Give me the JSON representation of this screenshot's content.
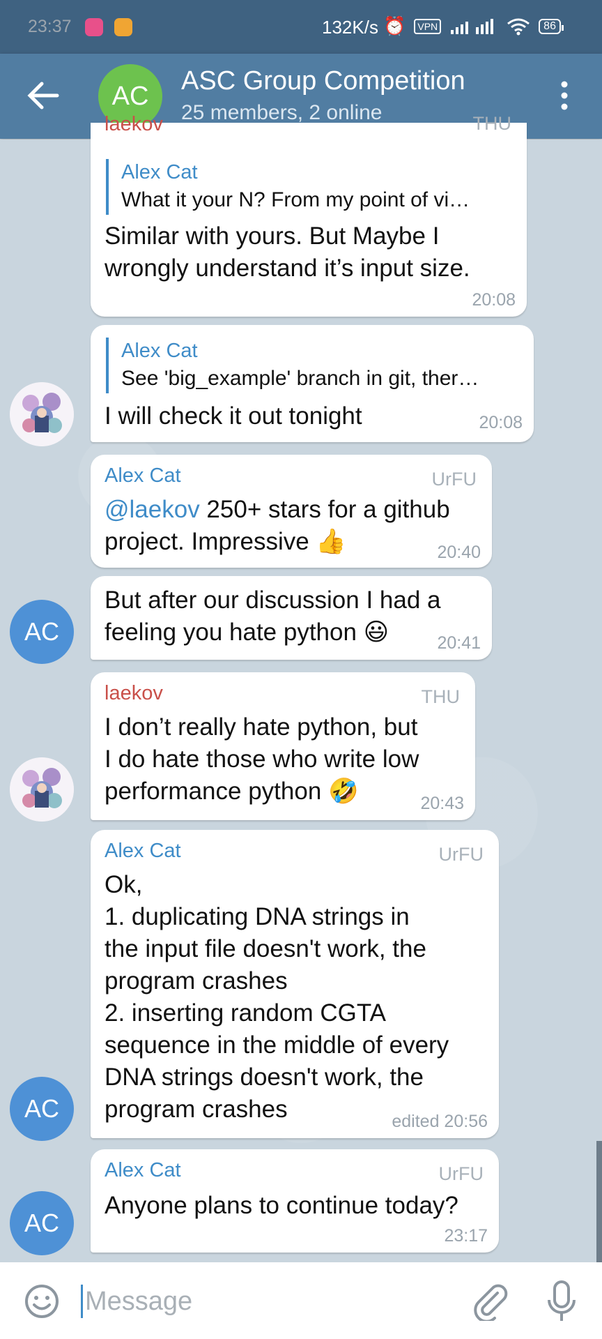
{
  "status_bar": {
    "time": "23:37",
    "speed": "132K/s",
    "vpn": "VPN",
    "battery": "86"
  },
  "header": {
    "avatar_initials": "AC",
    "title": "ASC Group Competition",
    "subtitle": "25 members, 2 online"
  },
  "messages": [
    {
      "reply_name": "Alex Cat",
      "reply_text": "What it your N? From my point of vi…",
      "text": "Similar with yours. But Maybe I\nwrongly understand it’s input size.",
      "time": "20:08",
      "partial_sender": "laekov",
      "partial_tag": "THU"
    },
    {
      "reply_name": "Alex Cat",
      "reply_text": "See 'big_example' branch in git, ther…",
      "text": "I will check it out tonight",
      "time": "20:08"
    },
    {
      "sender": "Alex Cat",
      "tag": "UrFU",
      "mention": "@laekov",
      "text_line1": " 250+ stars for a github",
      "text_line2": "project. Impressive 👍",
      "time": "20:40"
    },
    {
      "text": "But after our discussion I had a\nfeeling you hate python 😃",
      "time": "20:41",
      "avatar_initials": "AC"
    },
    {
      "sender": "laekov",
      "tag": "THU",
      "text": "I don’t really hate python, but\nI do hate those who write low\nperformance python 🤣",
      "time": "20:43"
    },
    {
      "sender": "Alex Cat",
      "tag": "UrFU",
      "text": "Ok,\n1. duplicating DNA strings in\nthe input file doesn't work, the\nprogram crashes\n2. inserting random CGTA\nsequence in the middle of every\nDNA strings doesn't work, the\nprogram crashes",
      "time": "edited 20:56",
      "avatar_initials": "AC"
    },
    {
      "sender": "Alex Cat",
      "tag": "UrFU",
      "text": "Anyone plans to continue today?",
      "time": "23:17",
      "avatar_initials": "AC"
    }
  ],
  "input": {
    "placeholder": "Message"
  }
}
